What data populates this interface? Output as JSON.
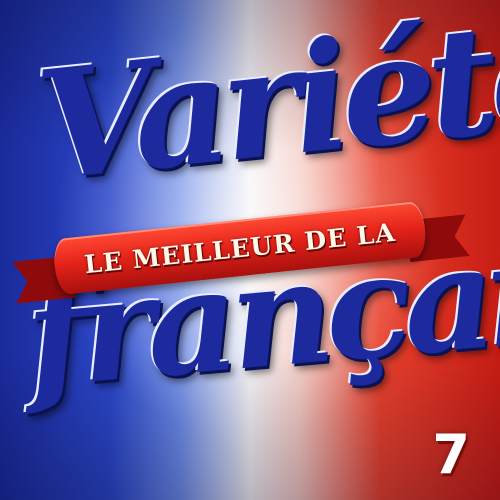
{
  "cover": {
    "title_top": "Variété",
    "ribbon_text": "LE MEILLEUR DE LA",
    "title_bottom": "française",
    "volume_number": "7"
  },
  "colors": {
    "blue": "#1d2a9e",
    "white": "#f4f2f4",
    "red": "#e5231a",
    "ribbon_dark": "#8f0b0b"
  }
}
